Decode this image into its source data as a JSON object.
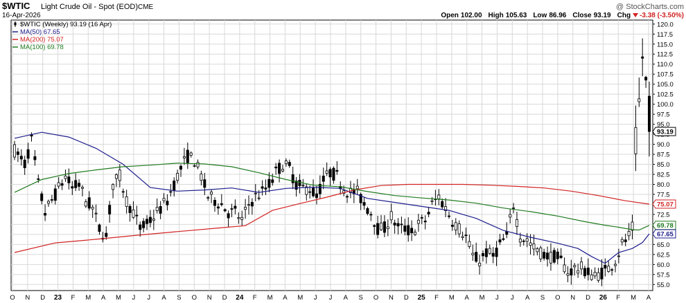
{
  "header": {
    "symbol": "$WTIC",
    "name": "Light Crude Oil - Spot (EOD)",
    "exchange": "CME",
    "date": "16-Apr-2026",
    "watermark": "@ StockCharts.com",
    "ohlc": [
      {
        "label": "Open",
        "value": "102.00"
      },
      {
        "label": "High",
        "value": "105.63"
      },
      {
        "label": "Low",
        "value": "86.96"
      },
      {
        "label": "Close",
        "value": "93.19"
      },
      {
        "label": "Chg",
        "value": "-3.38 (-3.50%)"
      }
    ],
    "chg_direction": "down"
  },
  "legend": [
    {
      "text": "$WTIC (Weekly) 93.19 (16 Apr)",
      "color": "#000000",
      "kind": "candle"
    },
    {
      "text": "MA(50) 67.65",
      "color": "#1c1c8c",
      "kind": "line"
    },
    {
      "text": "MA(200) 75.07",
      "color": "#d22222",
      "kind": "line"
    },
    {
      "text": "MA(100) 69.78",
      "color": "#1f7a1f",
      "kind": "line"
    }
  ],
  "price_tags": [
    {
      "value": 93.19,
      "text": "93.19",
      "color": "#000000"
    },
    {
      "value": 75.07,
      "text": "75.07",
      "color": "#d22222"
    },
    {
      "value": 69.78,
      "text": "69.78",
      "color": "#1f7a1f"
    },
    {
      "value": 67.65,
      "text": "67.65",
      "color": "#1c1c8c"
    }
  ],
  "chart_data": {
    "type": "candlestick",
    "y_ticks": [
      "55.0",
      "57.5",
      "60.0",
      "62.5",
      "65.0",
      "67.5",
      "70.0",
      "72.5",
      "75.0",
      "77.5",
      "80.0",
      "82.5",
      "85.0",
      "87.5",
      "90.0",
      "92.5",
      "95.0",
      "97.5",
      "100.0",
      "102.5",
      "105.0",
      "107.5",
      "110.0",
      "112.5",
      "115.0",
      "117.5",
      "120.0"
    ],
    "ylim": [
      53.5,
      121
    ],
    "x_labels": [
      "O",
      "N",
      "D",
      "23",
      "F",
      "M",
      "A",
      "M",
      "J",
      "J",
      "A",
      "S",
      "O",
      "N",
      "D",
      "24",
      "F",
      "M",
      "A",
      "M",
      "J",
      "J",
      "A",
      "S",
      "O",
      "N",
      "D",
      "25",
      "F",
      "M",
      "A",
      "M",
      "J",
      "J",
      "A",
      "S",
      "O",
      "N",
      "D",
      "26",
      "F",
      "M",
      "A"
    ],
    "x_label_bold": [
      "23",
      "24",
      "25",
      "26"
    ],
    "weeks": 188,
    "grid": true,
    "candle_anchors": [
      [
        0,
        88.5
      ],
      [
        3,
        85
      ],
      [
        5,
        91
      ],
      [
        7,
        80
      ],
      [
        9,
        73
      ],
      [
        11,
        76
      ],
      [
        13,
        79
      ],
      [
        15,
        82
      ],
      [
        17,
        79
      ],
      [
        19,
        80
      ],
      [
        21,
        76
      ],
      [
        23,
        74
      ],
      [
        25,
        69
      ],
      [
        27,
        67
      ],
      [
        29,
        80
      ],
      [
        31,
        82
      ],
      [
        33,
        76
      ],
      [
        35,
        73
      ],
      [
        37,
        69
      ],
      [
        39,
        70
      ],
      [
        41,
        72
      ],
      [
        43,
        74
      ],
      [
        45,
        76
      ],
      [
        47,
        80
      ],
      [
        49,
        84
      ],
      [
        51,
        87
      ],
      [
        53,
        86
      ],
      [
        55,
        82
      ],
      [
        57,
        77
      ],
      [
        59,
        76
      ],
      [
        61,
        75
      ],
      [
        63,
        73
      ],
      [
        65,
        73
      ],
      [
        67,
        71
      ],
      [
        69,
        75
      ],
      [
        71,
        77
      ],
      [
        73,
        78
      ],
      [
        75,
        80
      ],
      [
        77,
        83
      ],
      [
        79,
        85
      ],
      [
        81,
        84
      ],
      [
        83,
        80
      ],
      [
        85,
        79
      ],
      [
        87,
        79
      ],
      [
        89,
        77
      ],
      [
        91,
        81
      ],
      [
        93,
        83
      ],
      [
        95,
        82
      ],
      [
        97,
        79
      ],
      [
        99,
        78
      ],
      [
        101,
        78
      ],
      [
        103,
        75
      ],
      [
        105,
        73
      ],
      [
        107,
        69
      ],
      [
        109,
        69
      ],
      [
        111,
        72
      ],
      [
        113,
        69
      ],
      [
        115,
        69
      ],
      [
        117,
        68
      ],
      [
        119,
        70
      ],
      [
        121,
        71
      ],
      [
        123,
        75
      ],
      [
        125,
        77
      ],
      [
        127,
        74
      ],
      [
        129,
        71
      ],
      [
        131,
        69
      ],
      [
        133,
        67
      ],
      [
        135,
        62
      ],
      [
        137,
        61
      ],
      [
        139,
        63
      ],
      [
        141,
        62
      ],
      [
        143,
        65
      ],
      [
        145,
        67
      ],
      [
        147,
        75
      ],
      [
        149,
        67
      ],
      [
        151,
        66
      ],
      [
        153,
        64
      ],
      [
        155,
        63
      ],
      [
        157,
        62
      ],
      [
        159,
        62
      ],
      [
        161,
        61
      ],
      [
        163,
        58
      ],
      [
        165,
        59
      ],
      [
        167,
        59
      ],
      [
        169,
        58
      ],
      [
        171,
        57
      ],
      [
        173,
        58
      ],
      [
        175,
        59
      ],
      [
        177,
        61
      ],
      [
        179,
        65
      ],
      [
        181,
        67
      ],
      [
        182,
        69
      ],
      [
        183,
        90
      ],
      [
        184,
        100
      ],
      [
        185,
        112
      ],
      [
        186,
        105
      ],
      [
        187,
        93.2
      ]
    ],
    "series": [
      {
        "name": "$WTIC (Weekly) 93.19 (16 Apr)",
        "type": "candlestick"
      },
      {
        "name": "MA(50) 67.65",
        "type": "line",
        "color": "#1c1c8c",
        "points": [
          [
            0,
            91.5
          ],
          [
            8,
            93
          ],
          [
            16,
            91.8
          ],
          [
            24,
            89
          ],
          [
            32,
            85
          ],
          [
            40,
            79.2
          ],
          [
            48,
            78.3
          ],
          [
            56,
            78.6
          ],
          [
            64,
            79.1
          ],
          [
            72,
            78
          ],
          [
            80,
            79
          ],
          [
            88,
            79.3
          ],
          [
            96,
            79
          ],
          [
            104,
            76.5
          ],
          [
            112,
            75.5
          ],
          [
            120,
            74.5
          ],
          [
            128,
            73.5
          ],
          [
            136,
            71.5
          ],
          [
            144,
            68.5
          ],
          [
            152,
            66.8
          ],
          [
            160,
            65.3
          ],
          [
            166,
            64
          ],
          [
            170,
            62
          ],
          [
            174,
            60.3
          ],
          [
            178,
            63
          ],
          [
            182,
            64
          ],
          [
            185,
            65.5
          ],
          [
            187,
            67.65
          ]
        ]
      },
      {
        "name": "MA(200) 75.07",
        "type": "line",
        "color": "#d22222",
        "points": [
          [
            0,
            63
          ],
          [
            12,
            65.4
          ],
          [
            24,
            66.3
          ],
          [
            36,
            67.3
          ],
          [
            48,
            68.2
          ],
          [
            60,
            69.1
          ],
          [
            68,
            69.7
          ],
          [
            76,
            73.5
          ],
          [
            84,
            75.2
          ],
          [
            92,
            76.8
          ],
          [
            100,
            78.6
          ],
          [
            108,
            79.7
          ],
          [
            116,
            80
          ],
          [
            124,
            80
          ],
          [
            132,
            80
          ],
          [
            140,
            79.8
          ],
          [
            148,
            79.5
          ],
          [
            156,
            79.1
          ],
          [
            164,
            78.3
          ],
          [
            172,
            77.2
          ],
          [
            180,
            75.9
          ],
          [
            187,
            75.07
          ]
        ]
      },
      {
        "name": "MA(100) 69.78",
        "type": "line",
        "color": "#1f7a1f",
        "points": [
          [
            0,
            78
          ],
          [
            8,
            81.2
          ],
          [
            16,
            82.7
          ],
          [
            24,
            83.6
          ],
          [
            32,
            84.4
          ],
          [
            40,
            84.8
          ],
          [
            48,
            85.3
          ],
          [
            56,
            85.1
          ],
          [
            64,
            84.4
          ],
          [
            72,
            82.9
          ],
          [
            80,
            81.2
          ],
          [
            88,
            79.8
          ],
          [
            96,
            79.4
          ],
          [
            104,
            78.2
          ],
          [
            112,
            77.2
          ],
          [
            120,
            76.6
          ],
          [
            128,
            76.1
          ],
          [
            136,
            75.3
          ],
          [
            144,
            74.1
          ],
          [
            152,
            73.2
          ],
          [
            160,
            72.1
          ],
          [
            168,
            70.7
          ],
          [
            174,
            69.8
          ],
          [
            178,
            69.3
          ],
          [
            182,
            68.7
          ],
          [
            184,
            68.6
          ],
          [
            187,
            69.78
          ]
        ]
      }
    ]
  }
}
